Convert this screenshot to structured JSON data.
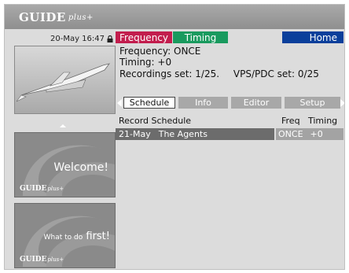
{
  "header": {
    "logo_main": "GUIDE",
    "logo_plus": "plus+"
  },
  "clock": "20-May 16:47",
  "color_keys": {
    "red": "Frequency",
    "green": "Timing",
    "blue": "Home",
    "red_color": "#c21d4d",
    "green_color": "#199a5e",
    "blue_color": "#0a3f9b"
  },
  "details": {
    "frequency_label": "Frequency:",
    "frequency_value": "ONCE",
    "timing_label": "Timing:",
    "timing_value": "+0",
    "recordings_label": "Recordings set:",
    "recordings_value": "1/25.",
    "vps_label": "VPS/PDC set:",
    "vps_value": "0/25"
  },
  "tabs": [
    {
      "label": "Schedule",
      "active": true
    },
    {
      "label": "Info",
      "active": false
    },
    {
      "label": "Editor",
      "active": false
    },
    {
      "label": "Setup",
      "active": false
    }
  ],
  "table": {
    "columns": {
      "schedule": "Record Schedule",
      "freq": "Freq",
      "timing": "Timing"
    },
    "rows": [
      {
        "date": "21-May",
        "title": "The Agents",
        "freq": "ONCE",
        "timing": "+0"
      }
    ]
  },
  "promos": [
    {
      "text": "Welcome!"
    },
    {
      "small": "What to do",
      "big": "first!"
    }
  ],
  "icons": [
    "lock-icon",
    "aircraft-image",
    "tab-scroll-left-icon",
    "tab-scroll-right-icon",
    "scroll-up-icon",
    "scroll-down-icon"
  ]
}
